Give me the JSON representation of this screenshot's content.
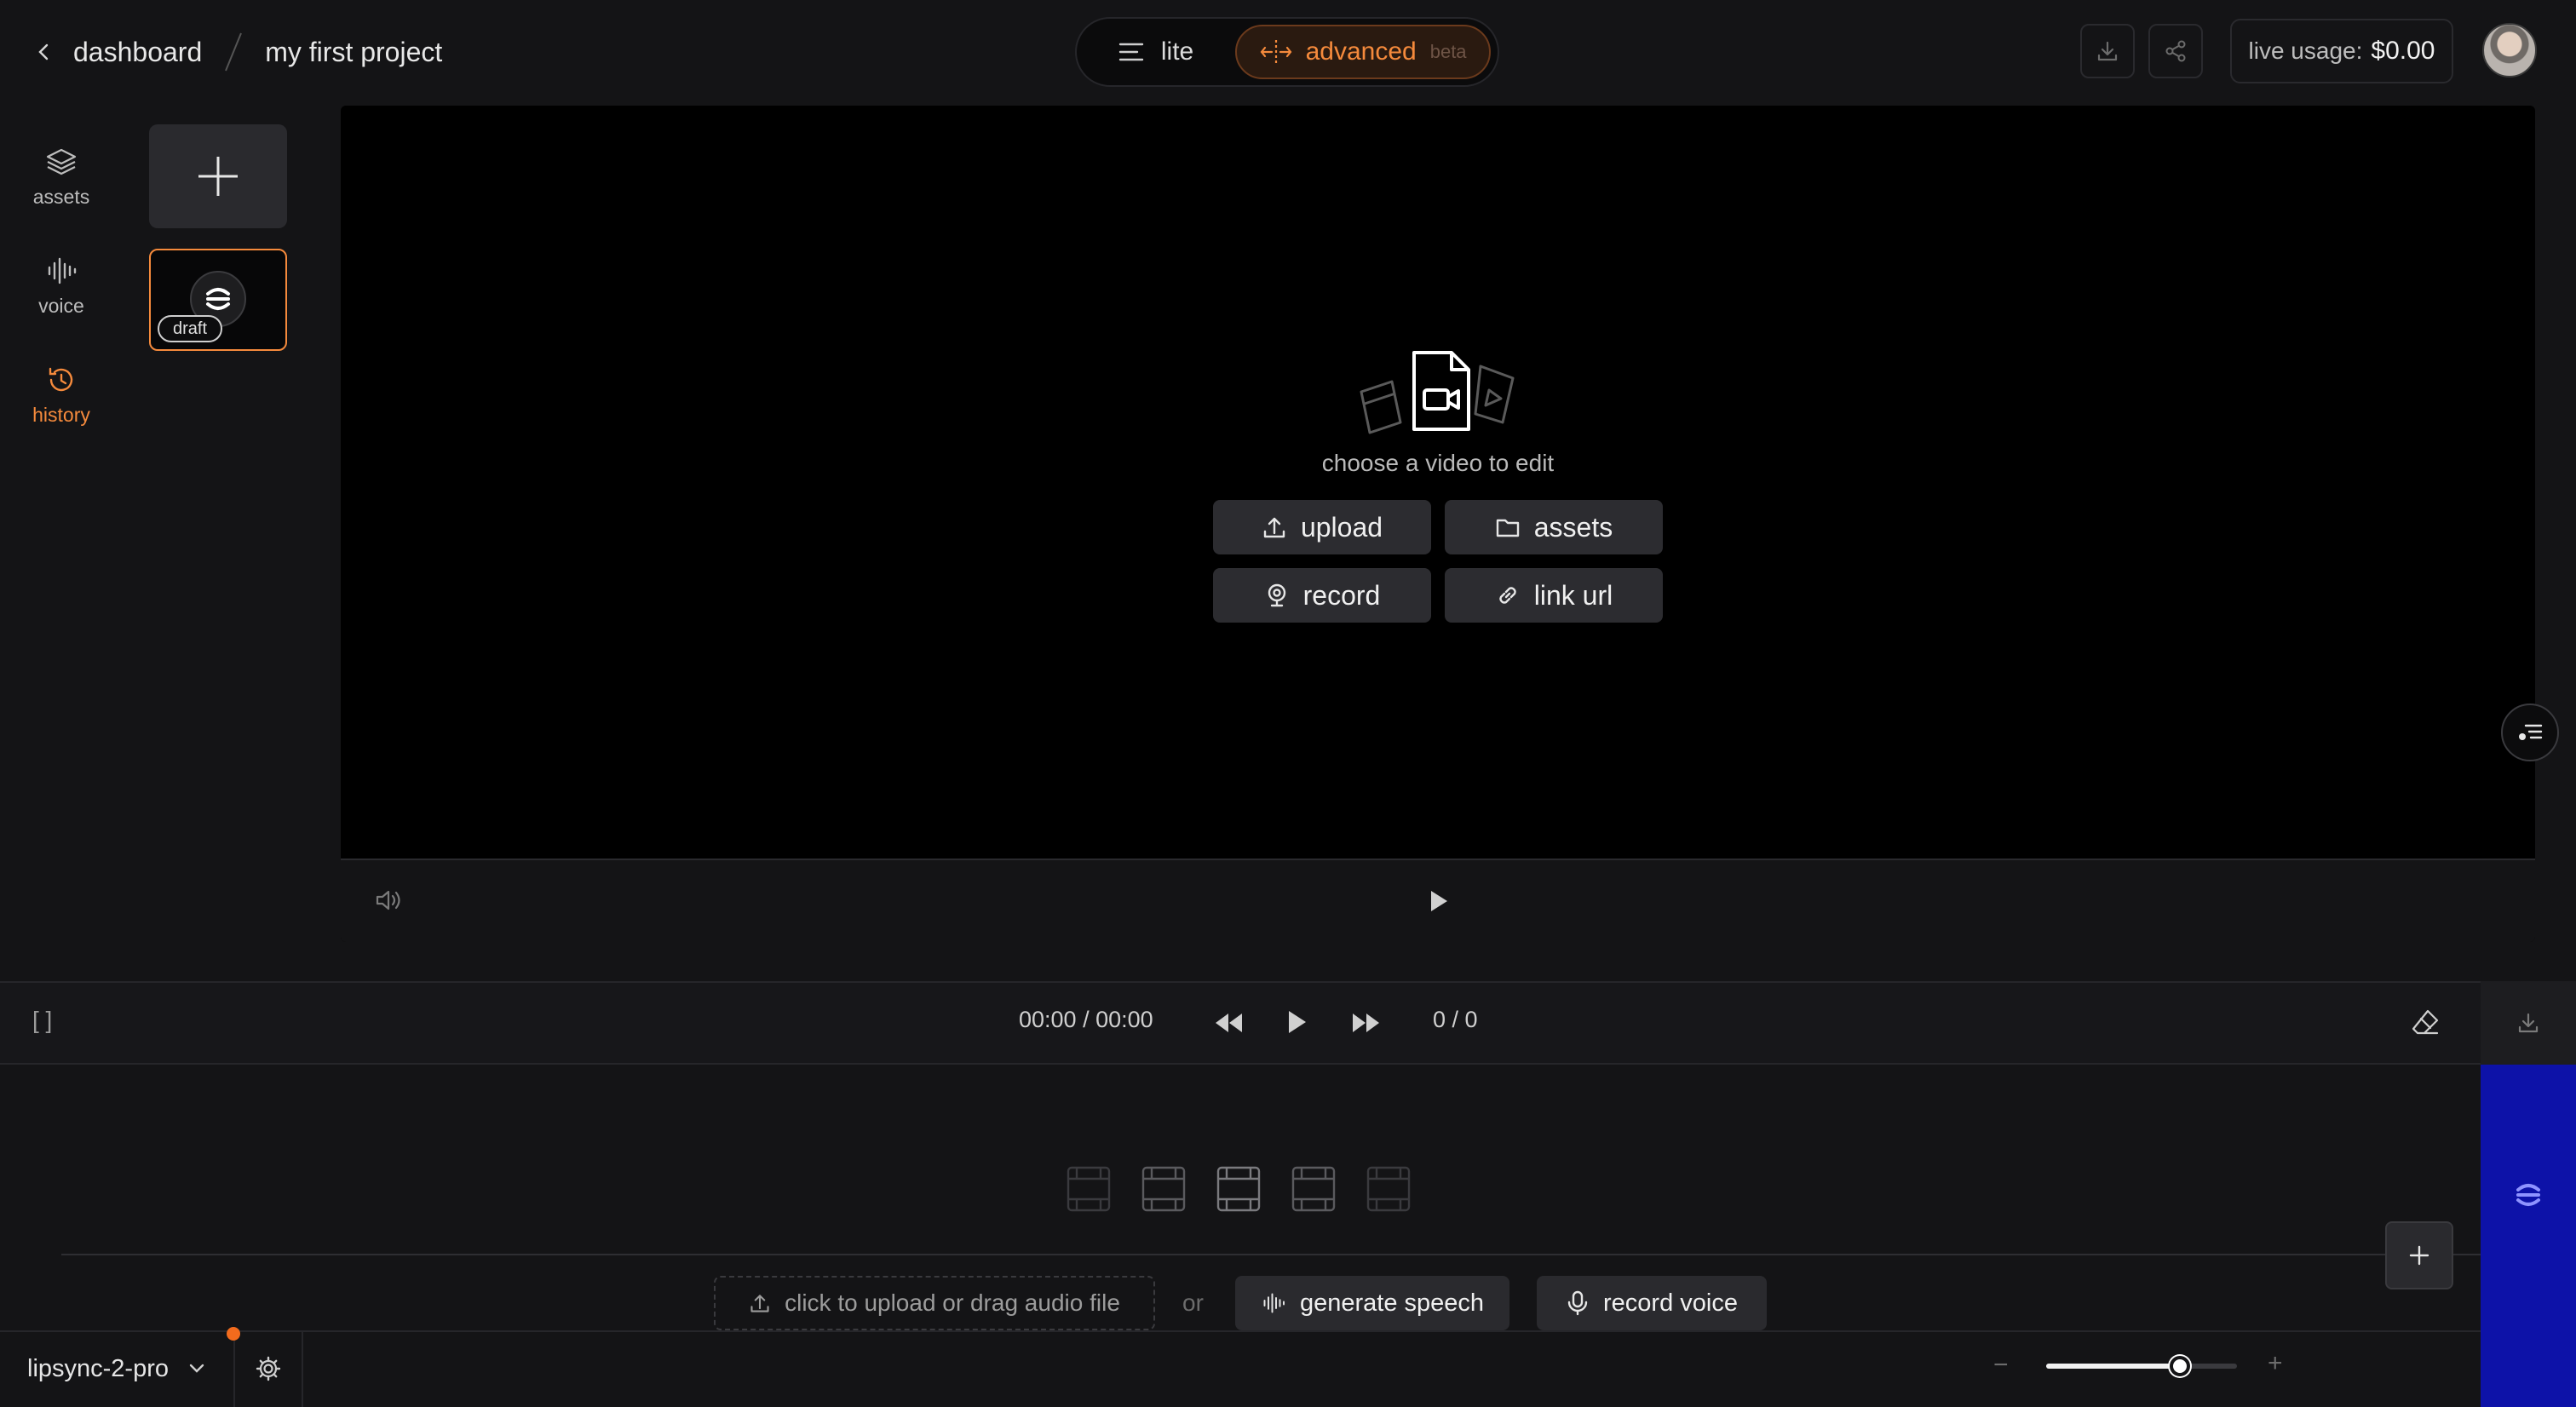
{
  "breadcrumb": {
    "back_label": "dashboard",
    "project": "my first project"
  },
  "mode": {
    "lite": "lite",
    "advanced": "advanced",
    "advanced_badge": "beta"
  },
  "header": {
    "usage_label": "live usage:",
    "usage_value": "$0.00"
  },
  "nav": [
    {
      "label": "assets",
      "icon": "layers-icon"
    },
    {
      "label": "voice",
      "icon": "waveform-icon"
    },
    {
      "label": "history",
      "icon": "history-icon",
      "active": true
    }
  ],
  "draft_badge": "draft",
  "video": {
    "prompt": "choose a video to edit",
    "actions": {
      "upload": "upload",
      "assets": "assets",
      "record": "record",
      "link_url": "link url"
    }
  },
  "timeline": {
    "brackets": "[ ]",
    "timecode": "00:00 / 00:00",
    "counter": "0 / 0"
  },
  "audio": {
    "upload": "click to upload or drag audio file",
    "or": "or",
    "generate": "generate speech",
    "record": "record voice"
  },
  "bottom": {
    "model": "lipsync-2-pro",
    "zoom": 0.7
  },
  "colors": {
    "accent": "#f58a3c",
    "panel_blue": "#0d12a8"
  }
}
